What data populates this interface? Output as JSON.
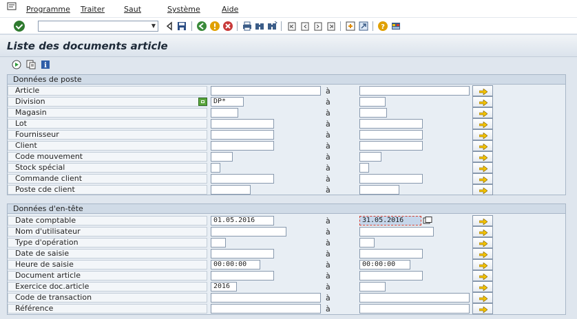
{
  "menubar": {
    "items": [
      "Programme",
      "Traiter",
      "Saut",
      "Système",
      "Aide"
    ]
  },
  "toolbar": {
    "command_value": "",
    "icons": [
      "ok-icon",
      "back-icon",
      "save-icon",
      "back-green-icon",
      "exit-icon",
      "cancel-icon",
      "print-icon",
      "find-icon",
      "find-next-icon",
      "first-page-icon",
      "prev-page-icon",
      "next-page-icon",
      "last-page-icon",
      "new-session-icon",
      "shortcut-icon",
      "help-icon",
      "layout-icon"
    ]
  },
  "title": "Liste des documents article",
  "app_toolbar": {
    "icons": [
      "execute-icon",
      "variant-icon",
      "info-icon"
    ]
  },
  "groups": {
    "poste": {
      "title": "Données de poste",
      "rows": [
        {
          "label": "Article",
          "from": "",
          "to": "",
          "a": "à"
        },
        {
          "label": "Division",
          "from": "DP*",
          "to": "",
          "a": "à"
        },
        {
          "label": "Magasin",
          "from": "",
          "to": "",
          "a": "à"
        },
        {
          "label": "Lot",
          "from": "",
          "to": "",
          "a": "à"
        },
        {
          "label": "Fournisseur",
          "from": "",
          "to": "",
          "a": "à"
        },
        {
          "label": "Client",
          "from": "",
          "to": "",
          "a": "à"
        },
        {
          "label": "Code mouvement",
          "from": "",
          "to": "",
          "a": "à"
        },
        {
          "label": "Stock spécial",
          "from": "",
          "to": "",
          "a": "à"
        },
        {
          "label": "Commande client",
          "from": "",
          "to": "",
          "a": "à"
        },
        {
          "label": "Poste cde client",
          "from": "",
          "to": "",
          "a": "à"
        }
      ]
    },
    "entete": {
      "title": "Données d'en-tête",
      "rows": [
        {
          "label": "Date comptable",
          "from": "01.05.2016",
          "to": "31.05.2016",
          "a": "à"
        },
        {
          "label": "Nom d'utilisateur",
          "from": "",
          "to": "",
          "a": "à"
        },
        {
          "label": "Type d'opération",
          "from": "",
          "to": "",
          "a": "à"
        },
        {
          "label": "Date de saisie",
          "from": "",
          "to": "",
          "a": "à"
        },
        {
          "label": "Heure de saisie",
          "from": "00:00:00",
          "to": "00:00:00",
          "a": "à"
        },
        {
          "label": "Document article",
          "from": "",
          "to": "",
          "a": "à"
        },
        {
          "label": "Exercice doc.article",
          "from": "2016",
          "to": "",
          "a": "à"
        },
        {
          "label": "Code de transaction",
          "from": "",
          "to": "",
          "a": "à"
        },
        {
          "label": "Référence",
          "from": "",
          "to": "",
          "a": "à"
        }
      ]
    }
  }
}
